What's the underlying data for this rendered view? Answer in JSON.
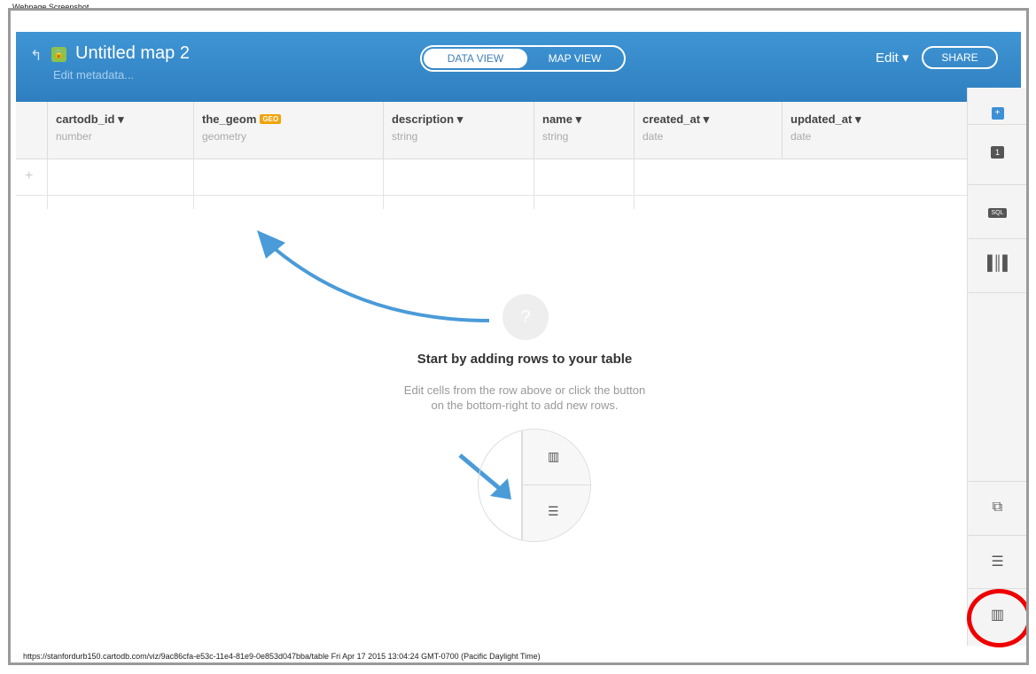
{
  "caption": "Webpage Screenshot",
  "header": {
    "title": "Untitled map 2",
    "metadata_link": "Edit metadata...",
    "data_view": "DATA VIEW",
    "map_view": "MAP VIEW",
    "edit": "Edit",
    "share": "SHARE"
  },
  "columns": [
    {
      "name": "cartodb_id",
      "type": "number"
    },
    {
      "name": "the_geom",
      "type": "geometry",
      "badge": "GEO"
    },
    {
      "name": "description",
      "type": "string"
    },
    {
      "name": "name",
      "type": "string"
    },
    {
      "name": "created_at",
      "type": "date"
    },
    {
      "name": "updated_at",
      "type": "date"
    }
  ],
  "empty": {
    "title": "Start by adding rows to your table",
    "line1": "Edit cells from the row above or click the button",
    "line2": "on the bottom-right to add new rows."
  },
  "sidebar": {
    "add_badge": "+",
    "count_badge": "1",
    "sql_badge": "SQL"
  },
  "status_bar": "https://stanfordurb150.cartodb.com/viz/9ac86cfa-e53c-11e4-81e9-0e853d047bba/table Fri Apr 17 2015 13:04:24 GMT-0700 (Pacific Daylight Time)"
}
